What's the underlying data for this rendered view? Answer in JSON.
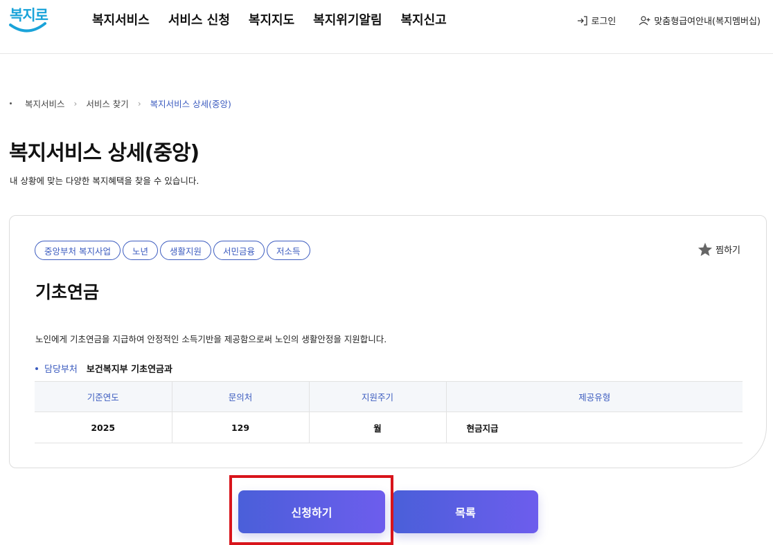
{
  "header": {
    "logo_text": "복지로",
    "nav": [
      "복지서비스",
      "서비스 신청",
      "복지지도",
      "복지위기알림",
      "복지신고"
    ],
    "login_label": "로그인",
    "membership_label": "맞춤형급여안내(복지멤버십)"
  },
  "breadcrumb": [
    "복지서비스",
    "서비스 찾기",
    "복지서비스 상세(중앙)"
  ],
  "page": {
    "title": "복지서비스 상세(중앙)",
    "description": "내 상황에 맞는 다양한 복지혜택을 찾을 수 있습니다."
  },
  "service": {
    "tags": [
      "중앙부처 복지사업",
      "노년",
      "생활지원",
      "서민금융",
      "저소득"
    ],
    "favorite_label": "찜하기",
    "title": "기초연금",
    "description": "노인에게 기초연금을 지급하여 안정적인 소득기반을 제공함으로써 노인의 생활안정을 지원합니다.",
    "dept_label": "담당부처",
    "dept_value": "보건복지부 기초연금과",
    "table": {
      "headers": [
        "기준연도",
        "문의처",
        "지원주기",
        "제공유형"
      ],
      "row": [
        "2025",
        "129",
        "월",
        "현금지급"
      ]
    }
  },
  "actions": {
    "apply_label": "신청하기",
    "list_label": "목록"
  },
  "colors": {
    "accent": "#3b5bbf",
    "button_gradient_start": "#4a5fd9",
    "button_gradient_end": "#6d5ded",
    "highlight": "#d8141b"
  }
}
